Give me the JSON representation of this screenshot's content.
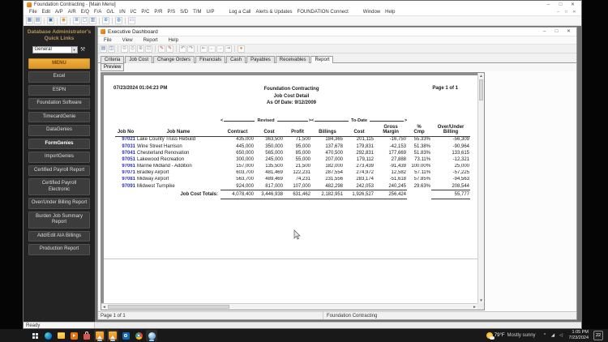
{
  "app": {
    "title": "Foundation Contracting - [Main Menu]",
    "menus": [
      {
        "label": "File"
      },
      {
        "label": "Edit"
      },
      {
        "label": "A/P"
      },
      {
        "label": "A/R"
      },
      {
        "label": "E/Q"
      },
      {
        "label": "F/A"
      },
      {
        "label": "G/L"
      },
      {
        "label": "I/N"
      },
      {
        "label": "I/C"
      },
      {
        "label": "P/C"
      },
      {
        "label": "P/R"
      },
      {
        "label": "P/S"
      },
      {
        "label": "S/D"
      },
      {
        "label": "T/M"
      },
      {
        "label": "U/P"
      },
      {
        "label": "Log a Call",
        "gap": true
      },
      {
        "label": "Alerts & Updates"
      },
      {
        "label": "FOUNDATION Connect"
      },
      {
        "label": "Window",
        "gap": true
      },
      {
        "label": "Help"
      }
    ],
    "toolbar_icons": [
      {
        "name": "tile-windows",
        "glyph": "▦",
        "color": "#4a78b5"
      },
      {
        "name": "print",
        "glyph": "▤",
        "color": "#4a78b5"
      },
      {
        "name": "sep"
      },
      {
        "name": "workspace",
        "glyph": "▣",
        "color": "#4a78b5"
      },
      {
        "name": "sep"
      },
      {
        "name": "locate",
        "glyph": "◉",
        "color": "#d58f2c"
      },
      {
        "name": "sep"
      },
      {
        "name": "list",
        "glyph": "≣",
        "color": "#4a78b5"
      },
      {
        "name": "new-doc",
        "glyph": "▢",
        "color": "#4a78b5"
      },
      {
        "name": "copy-doc",
        "glyph": "▥",
        "color": "#4a78b5"
      },
      {
        "name": "sep"
      },
      {
        "name": "add",
        "glyph": "⊕",
        "color": "#2d7dd2"
      },
      {
        "name": "sep"
      },
      {
        "name": "info",
        "glyph": "◍",
        "color": "#2d7dd2"
      },
      {
        "name": "sep"
      },
      {
        "name": "monitor",
        "glyph": "▭",
        "color": "#4a78b5"
      }
    ],
    "status_ready": "Ready"
  },
  "window_controls": {
    "minimize": "–",
    "maximize": "□",
    "close": "✕"
  },
  "icons": {
    "dropdown": "▾",
    "tools": "⚒",
    "up": "▲",
    "down": "▼",
    "left": "◄",
    "right": "►"
  },
  "sidebar": {
    "title_line1": "Database Administrator's",
    "title_line2": "Quick Links",
    "dropdown_value": "General",
    "buttons": [
      {
        "label": "MENU",
        "style": "accent"
      },
      {
        "label": "Excel"
      },
      {
        "label": "ESPN"
      },
      {
        "label": "Foundation Software"
      },
      {
        "label": "TimecardGenie"
      },
      {
        "label": "DataGenies"
      },
      {
        "label": "FormGenies",
        "style": "hl"
      },
      {
        "label": "ImportGenies"
      },
      {
        "label": "Certified Payroll Report"
      },
      {
        "label": "Certified Payroll Electronic"
      },
      {
        "label": "Over/Under Billing Report"
      },
      {
        "label": "Burden Job Summary Report"
      },
      {
        "label": "Add/Edit AIA Billings"
      },
      {
        "label": "Production Report"
      }
    ]
  },
  "dashboard": {
    "title": "Executive Dashboard",
    "menus": [
      "File",
      "View",
      "Report",
      "Help"
    ],
    "toolbar_icons": [
      {
        "name": "print",
        "glyph": "▤",
        "color": "#4a6ea9"
      },
      {
        "name": "export",
        "glyph": "◫",
        "color": "#4a6ea9"
      },
      {
        "name": "sep"
      },
      {
        "name": "zoom-out",
        "glyph": "⊖",
        "color": "#9a9a9a"
      },
      {
        "name": "zoom-normal",
        "glyph": "◎",
        "color": "#9a9a9a"
      },
      {
        "name": "zoom-in",
        "glyph": "⊕",
        "color": "#9a9a9a"
      },
      {
        "name": "zoom-fit",
        "glyph": "⊡",
        "color": "#9a9a9a"
      },
      {
        "name": "sep"
      },
      {
        "name": "marker",
        "glyph": "✎",
        "color": "#c0392b"
      },
      {
        "name": "marker-2",
        "glyph": "✎",
        "color": "#c0392b"
      },
      {
        "name": "sep"
      },
      {
        "name": "undo",
        "glyph": "↶",
        "color": "#7a7a7a"
      },
      {
        "name": "redo",
        "glyph": "↷",
        "color": "#7a7a7a"
      },
      {
        "name": "sep"
      },
      {
        "name": "first-page",
        "glyph": "⇤",
        "color": "#8a8aa0"
      },
      {
        "name": "prev-page",
        "glyph": "←",
        "color": "#8a8aa0"
      },
      {
        "name": "next-page",
        "glyph": "→",
        "color": "#8a8aa0"
      },
      {
        "name": "last-page",
        "glyph": "⇥",
        "color": "#8a8aa0"
      },
      {
        "name": "sep"
      },
      {
        "name": "stop",
        "glyph": "●",
        "color": "#e8821e"
      }
    ],
    "tabs": [
      {
        "label": "Criteria"
      },
      {
        "label": "Job Cost"
      },
      {
        "label": "Change Orders"
      },
      {
        "label": "Financials"
      },
      {
        "label": "Cash"
      },
      {
        "label": "Payables"
      },
      {
        "label": "Receivables"
      },
      {
        "label": "Report",
        "active": true
      }
    ],
    "preview_tab": "Preview",
    "status_left": "Page 1 of 1",
    "status_right": "Foundation Contracting"
  },
  "report": {
    "datetime": "07/23/2024  01:04:23 PM",
    "company": "Foundation Contracting",
    "title": "Job Cost Detail",
    "as_of": "As Of Date: 9/12/2009",
    "page": "Page 1 of 1",
    "group_revised": "Revised",
    "group_to_date": "To-Date",
    "columns": [
      {
        "key": "job_no",
        "label": "Job No",
        "align": "right"
      },
      {
        "key": "job_name",
        "label": "Job Name",
        "align": "left"
      },
      {
        "key": "contract",
        "label": "Contract",
        "align": "right"
      },
      {
        "key": "cost",
        "label": "Cost",
        "align": "right"
      },
      {
        "key": "profit",
        "label": "Profit",
        "align": "right"
      },
      {
        "key": "billings",
        "label": "Billings",
        "align": "right"
      },
      {
        "key": "td_cost",
        "label": "Cost",
        "align": "right"
      },
      {
        "key": "gross_margin",
        "label": "Gross\nMargin",
        "align": "right"
      },
      {
        "key": "pct_cmp",
        "label": "%\nCmp",
        "align": "right"
      },
      {
        "key": "over_under",
        "label": "Over/Under\nBilling",
        "align": "right"
      }
    ],
    "rows": [
      {
        "job_no": "97021",
        "job_name": "Lake County Truss Rebuild",
        "contract": "435,000",
        "cost": "363,500",
        "profit": "71,500",
        "billings": "184,365",
        "td_cost": "201,115",
        "gross_margin": "-16,750",
        "pct_cmp": "55.33%",
        "over_under": "-56,309"
      },
      {
        "job_no": "97031",
        "job_name": "Wine Street Harrison",
        "contract": "445,000",
        "cost": "350,000",
        "profit": "95,000",
        "billings": "137,678",
        "td_cost": "179,831",
        "gross_margin": "-42,153",
        "pct_cmp": "51.38%",
        "over_under": "-90,964"
      },
      {
        "job_no": "97041",
        "job_name": "Chesterland Renovation",
        "contract": "650,000",
        "cost": "565,000",
        "profit": "85,000",
        "billings": "470,500",
        "td_cost": "292,831",
        "gross_margin": "177,669",
        "pct_cmp": "51.83%",
        "over_under": "133,615"
      },
      {
        "job_no": "97051",
        "job_name": "Lakewood Recreation",
        "contract": "300,000",
        "cost": "245,000",
        "profit": "55,000",
        "billings": "207,000",
        "td_cost": "179,112",
        "gross_margin": "27,888",
        "pct_cmp": "73.11%",
        "over_under": "-12,321"
      },
      {
        "job_no": "97061",
        "job_name": "Marine Midland - Addition",
        "contract": "157,000",
        "cost": "135,500",
        "profit": "21,500",
        "billings": "182,000",
        "td_cost": "273,439",
        "gross_margin": "-91,439",
        "pct_cmp": "100.00%",
        "over_under": "25,000"
      },
      {
        "job_no": "97071",
        "job_name": "Bradley Airport",
        "contract": "603,700",
        "cost": "481,469",
        "profit": "122,231",
        "billings": "287,554",
        "td_cost": "274,972",
        "gross_margin": "12,582",
        "pct_cmp": "57.11%",
        "over_under": "-57,225"
      },
      {
        "job_no": "97081",
        "job_name": "Midway Airport",
        "contract": "563,700",
        "cost": "489,469",
        "profit": "74,231",
        "billings": "231,556",
        "td_cost": "283,174",
        "gross_margin": "-51,618",
        "pct_cmp": "57.85%",
        "over_under": "-94,563"
      },
      {
        "job_no": "97091",
        "job_name": "Midwest Turnpike",
        "contract": "924,000",
        "cost": "817,000",
        "profit": "107,000",
        "billings": "482,298",
        "td_cost": "242,053",
        "gross_margin": "240,245",
        "pct_cmp": "29.63%",
        "over_under": "208,544"
      }
    ],
    "totals": {
      "job_no": "",
      "job_name": "Job Cost Totals:",
      "contract": "4,078,400",
      "cost": "3,446,938",
      "profit": "631,462",
      "billings": "2,182,951",
      "td_cost": "1,926,527",
      "gross_margin": "256,424",
      "pct_cmp": "",
      "over_under": "55,777"
    }
  },
  "taskbar": {
    "apps": [
      {
        "name": "start"
      },
      {
        "name": "edge"
      },
      {
        "name": "explorer"
      },
      {
        "name": "media-player"
      },
      {
        "name": "store"
      },
      {
        "name": "foundation",
        "active": true
      },
      {
        "name": "foundation-2",
        "active": true
      },
      {
        "name": "outlook"
      },
      {
        "name": "chrome"
      },
      {
        "name": "dashboard-sphere",
        "active": true
      }
    ],
    "tray_icons": [
      {
        "name": "chevron-up",
        "glyph": "^"
      },
      {
        "name": "network",
        "glyph": "◢"
      },
      {
        "name": "volume",
        "glyph": "◁"
      }
    ],
    "weather_temp": "79°F",
    "weather_desc": "Mostly sunny",
    "time": "1:05 PM",
    "date": "7/23/2024",
    "notification_count": "22"
  }
}
